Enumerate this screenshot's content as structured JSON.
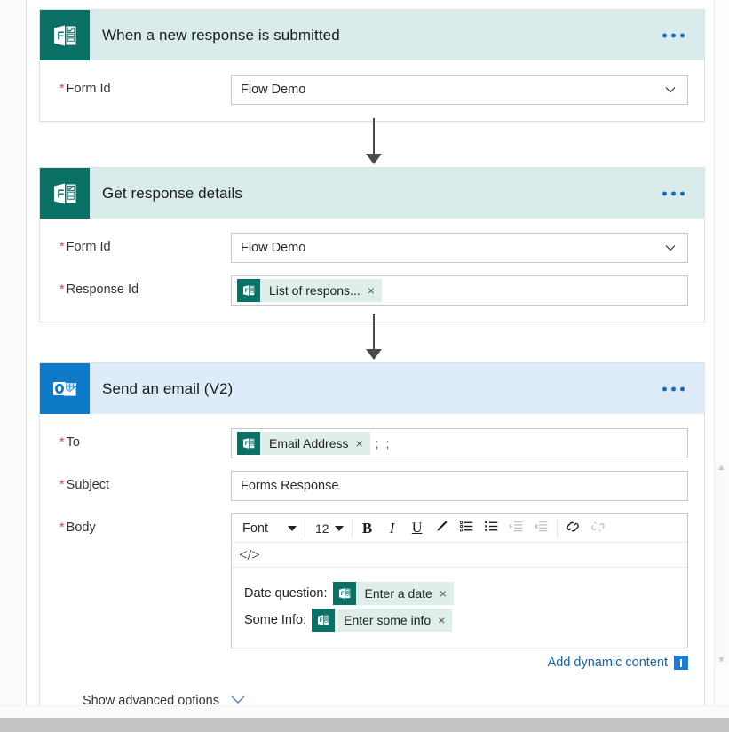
{
  "flow": {
    "cards": [
      {
        "id": "trigger",
        "connector": "microsoft-forms",
        "title": "When a new response is submitted",
        "menu_label": "More commands",
        "fields": [
          {
            "label": "Form Id",
            "required": true,
            "type": "dropdown",
            "value": "Flow Demo"
          }
        ]
      },
      {
        "id": "get-response-details",
        "connector": "microsoft-forms",
        "title": "Get response details",
        "menu_label": "More commands",
        "fields": [
          {
            "label": "Form Id",
            "required": true,
            "type": "dropdown",
            "value": "Flow Demo"
          },
          {
            "label": "Response Id",
            "required": true,
            "type": "token",
            "token": {
              "label": "List of respons...",
              "icon": "microsoft-forms-icon",
              "remove": "×"
            },
            "trailing": ""
          }
        ]
      },
      {
        "id": "send-an-email-v2",
        "connector": "outlook",
        "title": "Send an email (V2)",
        "menu_label": "More commands",
        "fields": [
          {
            "label": "To",
            "required": true,
            "type": "token",
            "token": {
              "label": "Email Address",
              "icon": "microsoft-forms-icon",
              "remove": "×"
            },
            "trailing": "; ;"
          },
          {
            "label": "Subject",
            "required": true,
            "type": "text",
            "value": "Forms Response"
          },
          {
            "label": "Body",
            "required": true,
            "type": "richtext"
          }
        ]
      }
    ]
  },
  "editor": {
    "font_select": {
      "value": "Font",
      "caret": "chevron-down"
    },
    "size_select": {
      "value": "12",
      "caret": "chevron-down"
    },
    "buttons": [
      {
        "name": "bold",
        "glyph": "B",
        "disabled": false
      },
      {
        "name": "italic",
        "glyph": "I",
        "disabled": false
      },
      {
        "name": "underline",
        "glyph": "U",
        "disabled": false
      },
      {
        "name": "text-color",
        "glyph": "pen",
        "disabled": false
      },
      {
        "name": "bulleted-list",
        "glyph": "bullets",
        "disabled": false
      },
      {
        "name": "numbered-list",
        "glyph": "numbers",
        "disabled": false
      },
      {
        "name": "indent-increase",
        "glyph": "indent",
        "disabled": true
      },
      {
        "name": "indent-decrease",
        "glyph": "outdent",
        "disabled": true
      },
      {
        "name": "insert-link",
        "glyph": "link",
        "disabled": false
      },
      {
        "name": "remove-link",
        "glyph": "unlink",
        "disabled": true
      }
    ],
    "code_view": "</>",
    "body_lines": [
      {
        "label": "Date question:",
        "token": {
          "label": "Enter a date",
          "icon": "microsoft-forms-icon",
          "remove": "×"
        }
      },
      {
        "label": "Some Info:",
        "token": {
          "label": "Enter some info",
          "icon": "microsoft-forms-icon",
          "remove": "×"
        }
      }
    ]
  },
  "dynamic_content": {
    "link_label": "Add dynamic content",
    "badge": "dynamic-content-icon"
  },
  "advanced": {
    "label": "Show advanced options",
    "caret": "chevron-down"
  },
  "colors": {
    "forms_brand": "#0b7066",
    "forms_header": "#d9eceb",
    "outlook_brand": "#0f7ac8",
    "outlook_header": "#deecf9",
    "required_asterisk": "#cc4a45",
    "link": "#1264a3",
    "token_bg": "#dfeeea",
    "connector_arrow": "#4a4a4a"
  }
}
